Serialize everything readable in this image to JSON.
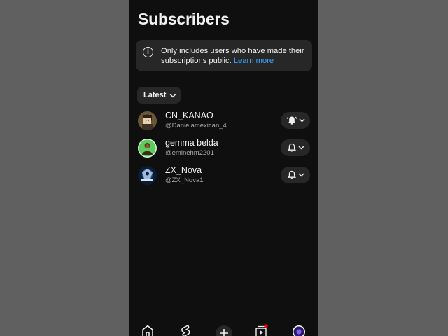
{
  "page": {
    "title": "Subscribers"
  },
  "info": {
    "icon": "info-icon",
    "text": "Only includes users who have made their subscriptions public.",
    "link": "Learn more"
  },
  "filter": {
    "label": "Latest",
    "icon": "chevron-down-icon"
  },
  "subscribers": [
    {
      "name": "CN_KANAO",
      "handle": "@Danielamexican_4",
      "notification": "all",
      "bell_icon": "bell-ringing-icon"
    },
    {
      "name": "gemma belda",
      "handle": "@eminehm2201",
      "notification": "personalized",
      "bell_icon": "bell-icon"
    },
    {
      "name": "ZX_Nova",
      "handle": "@ZX_Nova1",
      "notification": "personalized",
      "bell_icon": "bell-icon"
    }
  ],
  "bottom_nav": {
    "items": [
      "home-icon",
      "shorts-icon",
      "create-icon",
      "subscriptions-icon",
      "profile-avatar"
    ],
    "notification_dot_color": "#ff0000"
  },
  "colors": {
    "background": "#0f0f0f",
    "surface": "#272727",
    "text": "#f1f1f1",
    "secondary_text": "#aaaaaa",
    "link": "#3ea6ff"
  }
}
